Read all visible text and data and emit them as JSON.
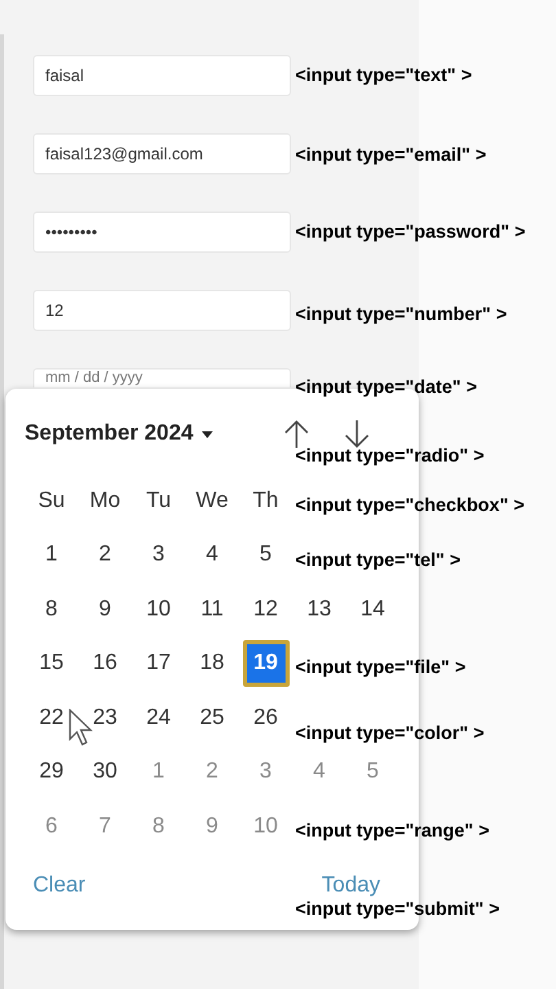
{
  "form": {
    "fields": [
      {
        "kind": "text",
        "value": "faisal"
      },
      {
        "kind": "email",
        "value": "faisal123@gmail.com"
      },
      {
        "kind": "password",
        "value": "•••••••••"
      },
      {
        "kind": "number",
        "value": "12"
      },
      {
        "kind": "date",
        "placeholder": "mm / dd / yyyy"
      }
    ]
  },
  "date_picker": {
    "month_label": "September 2024",
    "weekdays": [
      "Su",
      "Mo",
      "Tu",
      "We",
      "Th"
    ],
    "weeks": [
      [
        {
          "day": "1",
          "in_month": true,
          "selected": false
        },
        {
          "day": "2",
          "in_month": true,
          "selected": false
        },
        {
          "day": "3",
          "in_month": true,
          "selected": false
        },
        {
          "day": "4",
          "in_month": true,
          "selected": false
        },
        {
          "day": "5",
          "in_month": true,
          "selected": false
        }
      ],
      [
        {
          "day": "8",
          "in_month": true,
          "selected": false
        },
        {
          "day": "9",
          "in_month": true,
          "selected": false
        },
        {
          "day": "10",
          "in_month": true,
          "selected": false
        },
        {
          "day": "11",
          "in_month": true,
          "selected": false
        },
        {
          "day": "12",
          "in_month": true,
          "selected": false
        },
        {
          "day": "13",
          "in_month": true,
          "selected": false
        },
        {
          "day": "14",
          "in_month": true,
          "selected": false
        }
      ],
      [
        {
          "day": "15",
          "in_month": true,
          "selected": false
        },
        {
          "day": "16",
          "in_month": true,
          "selected": false
        },
        {
          "day": "17",
          "in_month": true,
          "selected": false
        },
        {
          "day": "18",
          "in_month": true,
          "selected": false
        },
        {
          "day": "19",
          "in_month": true,
          "selected": true
        }
      ],
      [
        {
          "day": "22",
          "in_month": true,
          "selected": false
        },
        {
          "day": "23",
          "in_month": true,
          "selected": false
        },
        {
          "day": "24",
          "in_month": true,
          "selected": false
        },
        {
          "day": "25",
          "in_month": true,
          "selected": false
        },
        {
          "day": "26",
          "in_month": true,
          "selected": false
        }
      ],
      [
        {
          "day": "29",
          "in_month": true,
          "selected": false
        },
        {
          "day": "30",
          "in_month": true,
          "selected": false
        },
        {
          "day": "1",
          "in_month": false,
          "selected": false
        },
        {
          "day": "2",
          "in_month": false,
          "selected": false
        },
        {
          "day": "3",
          "in_month": false,
          "selected": false
        },
        {
          "day": "4",
          "in_month": false,
          "selected": false
        },
        {
          "day": "5",
          "in_month": false,
          "selected": false
        }
      ],
      [
        {
          "day": "6",
          "in_month": false,
          "selected": false
        },
        {
          "day": "7",
          "in_month": false,
          "selected": false
        },
        {
          "day": "8",
          "in_month": false,
          "selected": false
        },
        {
          "day": "9",
          "in_month": false,
          "selected": false
        },
        {
          "day": "10",
          "in_month": false,
          "selected": false
        }
      ]
    ],
    "clear": "Clear",
    "today": "Today"
  },
  "captions": [
    "<input type=\"text\" >",
    "<input type=\"email\" >",
    "<input type=\"password\" >",
    "<input type=\"number\" >",
    "<input type=\"date\" >",
    "<input type=\"radio\" >",
    "<input type=\"checkbox\" >",
    "<input type=\"tel\" >",
    "<input type=\"file\" >",
    "<input type=\"color\" >",
    "<input type=\"range\" >",
    "<input type=\"submit\" >"
  ]
}
